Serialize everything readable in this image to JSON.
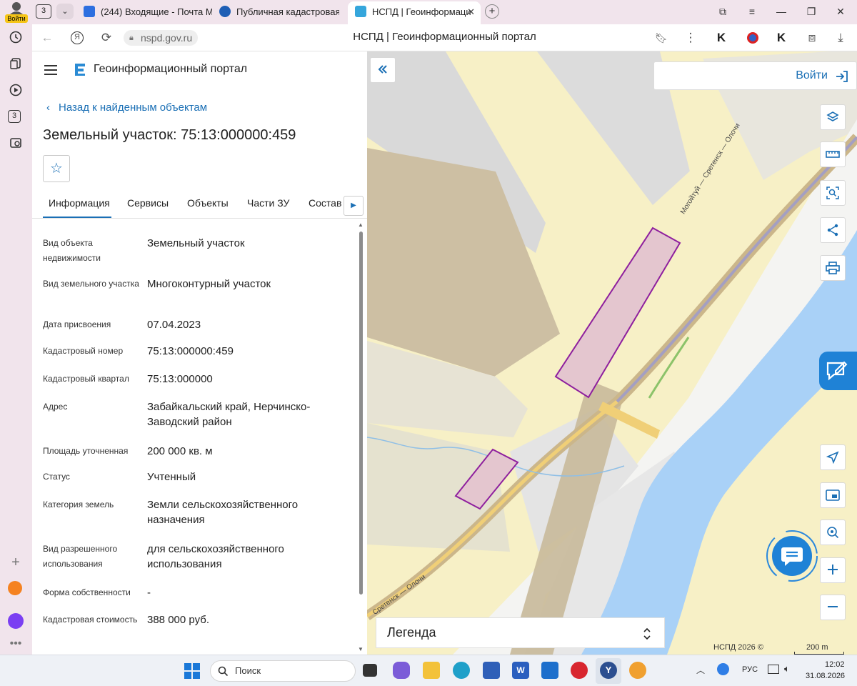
{
  "browser": {
    "profile_label": "Войти",
    "tab_count": "3",
    "sidebar_badge": "3",
    "tabs": [
      {
        "label": "(244) Входящие - Почта М"
      },
      {
        "label": "Публичная кадастровая к"
      },
      {
        "label": "НСПД | Геоинформаци"
      }
    ],
    "url": "nspd.gov.ru",
    "page_title": "НСПД | Геоинформационный портал"
  },
  "panel": {
    "portal_name": "Геоинформационный портал",
    "back_link": "Назад к найденным объектам",
    "object_title": "Земельный участок: 75:13:000000:459",
    "tabs": [
      {
        "label": "Информация"
      },
      {
        "label": "Сервисы"
      },
      {
        "label": "Объекты"
      },
      {
        "label": "Части ЗУ"
      },
      {
        "label": "Состав"
      }
    ],
    "properties": [
      {
        "label": "Вид объекта недвижимости",
        "value": "Земельный участок"
      },
      {
        "label": "Вид земельного участка",
        "value": "Многоконтурный участок"
      },
      {
        "label": "Дата присвоения",
        "value": "07.04.2023"
      },
      {
        "label": "Кадастровый номер",
        "value": "75:13:000000:459"
      },
      {
        "label": "Кадастровый квартал",
        "value": "75:13:000000"
      },
      {
        "label": "Адрес",
        "value": "Забайкальский край, Нерчинско-Заводский район"
      },
      {
        "label": "Площадь уточненная",
        "value": "200 000 кв. м"
      },
      {
        "label": "Статус",
        "value": "Учтенный"
      },
      {
        "label": "Категория земель",
        "value": "Земли сельскохозяйственного назначения"
      },
      {
        "label": "Вид разрешенного использования",
        "value": "для сельскохозяйственного использования"
      },
      {
        "label": "Форма собственности",
        "value": "-"
      },
      {
        "label": "Кадастровая стоимость",
        "value": "388 000 руб."
      }
    ]
  },
  "map": {
    "login_label": "Войти",
    "legend_label": "Легенда",
    "attribution": "НСПД 2026 ©",
    "scale_label": "200 m",
    "road_label_top": "Могойтуй — Сретенск — Олочи",
    "road_label_bottom": "Сретенск — Олочи",
    "parcel_color": "#8e1f9e"
  },
  "taskbar": {
    "search_placeholder": "Поиск",
    "language": "РУС",
    "time": "12:02",
    "date": "31.08.2026"
  }
}
